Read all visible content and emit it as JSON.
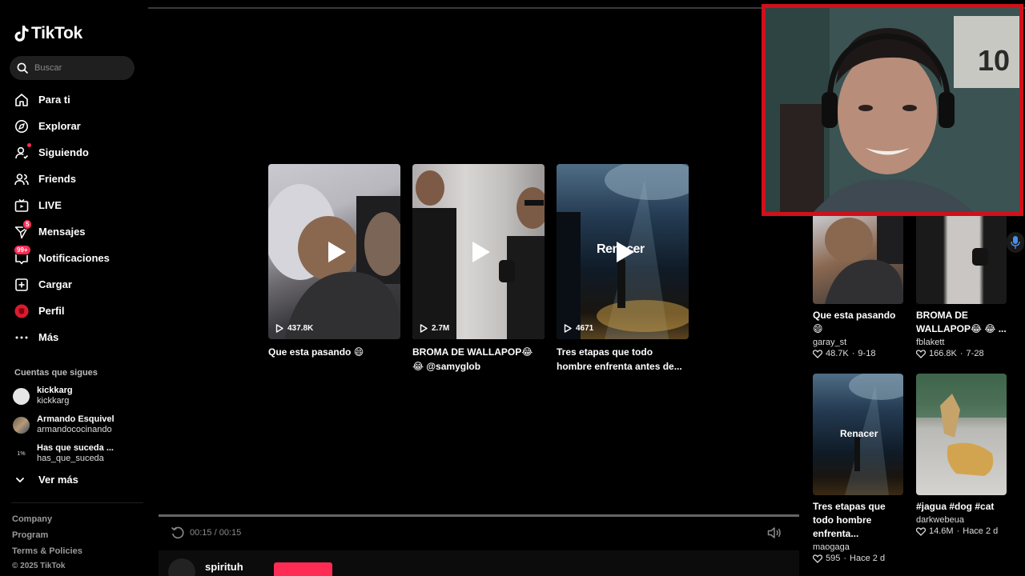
{
  "brand": {
    "name": "TikTok"
  },
  "search": {
    "placeholder": "Buscar"
  },
  "nav": [
    {
      "label": "Para ti",
      "icon": "home-icon"
    },
    {
      "label": "Explorar",
      "icon": "compass-icon"
    },
    {
      "label": "Siguiendo",
      "icon": "following-icon"
    },
    {
      "label": "Friends",
      "icon": "friends-icon"
    },
    {
      "label": "LIVE",
      "icon": "live-icon"
    },
    {
      "label": "Mensajes",
      "icon": "messages-icon",
      "badge": "5"
    },
    {
      "label": "Notificaciones",
      "icon": "inbox-icon",
      "badge": "99+"
    },
    {
      "label": "Cargar",
      "icon": "upload-icon"
    },
    {
      "label": "Perfil",
      "icon": "profile-avatar-icon"
    },
    {
      "label": "Más",
      "icon": "more-icon"
    }
  ],
  "following": {
    "title": "Cuentas que sigues",
    "accounts": [
      {
        "name": "kickkarg",
        "handle": "kickkarg"
      },
      {
        "name": "Armando Esquivel",
        "handle": "armandococinando"
      },
      {
        "name": "Has que suceda ...",
        "handle": "has_que_suceda",
        "avatar_text": "1%"
      }
    ],
    "more_label": "Ver más"
  },
  "footer": {
    "company": "Company",
    "program": "Program",
    "terms": "Terms & Policies",
    "copyright": "© 2025 TikTok"
  },
  "center_videos": [
    {
      "views": "437.8K",
      "title": "Que esta pasando 😄"
    },
    {
      "views": "2.7M",
      "title": "BROMA DE WALLAPOP😂 😂 @samyglob"
    },
    {
      "views": "4671",
      "title": "Tres etapas que todo hombre enfrenta antes de...",
      "overlay": "Renacer"
    }
  ],
  "player": {
    "time": "00:15 / 00:15",
    "progress": 1.0,
    "author": "spirituh"
  },
  "right_videos": [
    {
      "title": "Que esta pasando 😄",
      "author": "garay_st",
      "likes": "48.7K",
      "date": "9-18"
    },
    {
      "title": "BROMA DE WALLAPOP😂 😂 ...",
      "author": "fblakett",
      "likes": "166.8K",
      "date": "7-28"
    },
    {
      "title": "Tres etapas que todo hombre enfrenta...",
      "author": "maogaga",
      "likes": "595",
      "date": "Hace 2 d",
      "overlay": "Renacer"
    },
    {
      "title": "#jagua #dog #cat",
      "author": "darkwebeua",
      "likes": "14.6M",
      "date": "Hace 2 d"
    }
  ],
  "colors": {
    "accent": "#fe2c55",
    "webcam_border": "#d0101a",
    "background": "#000000"
  }
}
